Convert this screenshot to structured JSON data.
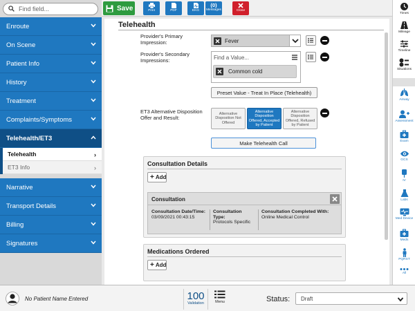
{
  "search": {
    "placeholder": "Find field..."
  },
  "toolbar": {
    "save_label": "Save",
    "print_label": "Print",
    "pdf_label": "PDF",
    "ekg_label": "EKG",
    "messages_count": "(0)",
    "messages_label": "Messages",
    "close_label": "Close"
  },
  "nav": {
    "enroute": "Enroute",
    "on_scene": "On Scene",
    "patient_info": "Patient Info",
    "history": "History",
    "treatment": "Treatment",
    "complaints": "Complaints/Symptoms",
    "telehealth_et3": "Telehealth/ET3",
    "sub_telehealth": "Telehealth",
    "sub_et3_info": "ET3 Info",
    "narrative": "Narrative",
    "transport": "Transport Details",
    "billing": "Billing",
    "signatures": "Signatures"
  },
  "main": {
    "title": "Telehealth",
    "primary_label": "Provider's Primary Impression:",
    "primary_value": "Fever",
    "secondary_label": "Provider's Secondary Impressions:",
    "secondary_placeholder": "Find a Value...",
    "secondary_chip": "Common cold",
    "preset_label": "Preset Value - Treat In Place (Telehealth)",
    "et3_label": "ET3 Alternative Disposition Offer and Result:",
    "disp_not_offered": "Alternative Disposition Not Offered",
    "disp_accepted": "Alternative Disposition Offered, Accepted by Patient",
    "disp_refused": "Alternative Disposition Offered, Refused by Patient",
    "call_label": "Make Telehealth Call",
    "consult_details_title": "Consultation Details",
    "add_label": "Add",
    "consult_card_title": "Consultation",
    "cc_date_key": "Consultation Date/Time:",
    "cc_date_val": "03/09/2021 00:43:15",
    "cc_type_key": "Consultation Type:",
    "cc_type_val": "Protocols Specific",
    "cc_with_key": "Consultation Completed With:",
    "cc_with_val": "Online Medical Control",
    "meds_title": "Medications Ordered",
    "meds_add_label": "Add"
  },
  "rail": {
    "times": "Times",
    "mileage": "Mileage",
    "timeline": "Timeline",
    "situations": "Situations",
    "airway": "Airway",
    "assessment": "Assessment",
    "exam": "Exam",
    "gcs": "GCS",
    "iv": "IV",
    "labs": "Labs",
    "med_device": "Med Device",
    "meds": "Meds",
    "pqrst": "PQRST",
    "all": "All"
  },
  "bottom": {
    "patient_name": "No Patient Name Entered",
    "validation_count": "100",
    "validation_label": "Validation",
    "menu_label": "Menu",
    "status_label": "Status:",
    "status_value": "Draft"
  },
  "colors": {
    "nav_blue": "#1f78c0",
    "nav_active": "#0f4f86",
    "save_green": "#2e9b3f",
    "close_red": "#d01f2b"
  }
}
